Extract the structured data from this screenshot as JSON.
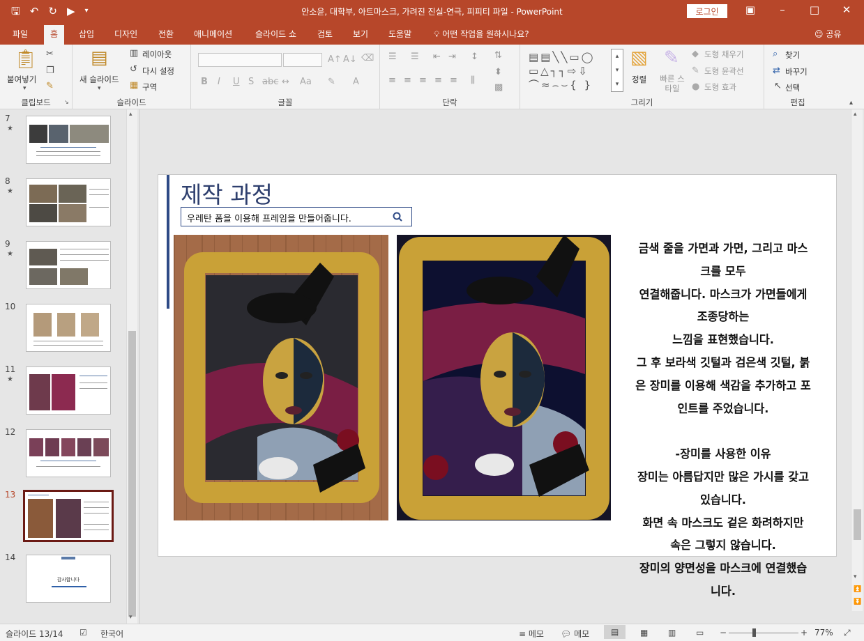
{
  "window": {
    "title": "안소윤, 대학부, 아트마스크, 가려진 진실-연극, 피피티 파일  -  PowerPoint",
    "login": "로그인"
  },
  "menu": {
    "tabs": [
      "파일",
      "홈",
      "삽입",
      "디자인",
      "전환",
      "애니메이션",
      "슬라이드 쇼",
      "검토",
      "보기",
      "도움말"
    ],
    "active_tab": "홈",
    "tell_me": "어떤 작업을 원하시나요?",
    "share": "공유"
  },
  "ribbon": {
    "clipboard": {
      "label": "클립보드",
      "paste": "붙여넣기"
    },
    "slides": {
      "label": "슬라이드",
      "new_slide": "새 슬라이드",
      "layout": "레이아웃",
      "reset": "다시 설정",
      "section": "구역"
    },
    "font": {
      "label": "글꼴"
    },
    "paragraph": {
      "label": "단락"
    },
    "drawing": {
      "label": "그리기",
      "arrange": "정렬",
      "quick_styles": "빠른 스타일",
      "shape_fill": "도형 채우기",
      "shape_outline": "도형 윤곽선",
      "shape_effects": "도형 효과"
    },
    "editing": {
      "label": "편집",
      "find": "찾기",
      "replace": "바꾸기",
      "select": "선택"
    }
  },
  "thumbnails": [
    {
      "number": "7",
      "star": "★"
    },
    {
      "number": "8",
      "star": "★"
    },
    {
      "number": "9",
      "star": "★"
    },
    {
      "number": "10",
      "star": ""
    },
    {
      "number": "11",
      "star": "★"
    },
    {
      "number": "12",
      "star": ""
    },
    {
      "number": "13",
      "star": ""
    },
    {
      "number": "14",
      "star": "",
      "caption": "감사합니다"
    }
  ],
  "slide": {
    "title": "제작 과정",
    "search_text": "우레탄 폼을 이용해 프레임을 만들어줍니다.",
    "body_lines": [
      "금색 줄을 가면과 가면, 그리고 마스",
      "크를 모두",
      "연결해줍니다. 마스크가 가면들에게",
      "조종당하는",
      "느낌을 표현했습니다.",
      "그 후 보라색 깃털과 검은색 깃털, 붉",
      "은 장미를 이용해 색감을 추가하고 포",
      "인트를 주었습니다.",
      "",
      "-장미를 사용한 이유",
      "장미는 아름답지만 많은 가시를 갖고",
      "있습니다.",
      "화면 속 마스크도 겉은 화려하지만",
      "속은 그렇지 않습니다.",
      "장미의 양면성을 마스크에 연결했습",
      "니다."
    ]
  },
  "status": {
    "slide_counter": "슬라이드 13/14",
    "language": "한국어",
    "notes": "메모",
    "comments": "메모",
    "zoom": "77%"
  },
  "colors": {
    "brand": "#b7472a",
    "slide_accent": "#2e4a86",
    "current_thumb_border": "#6b1a14"
  }
}
